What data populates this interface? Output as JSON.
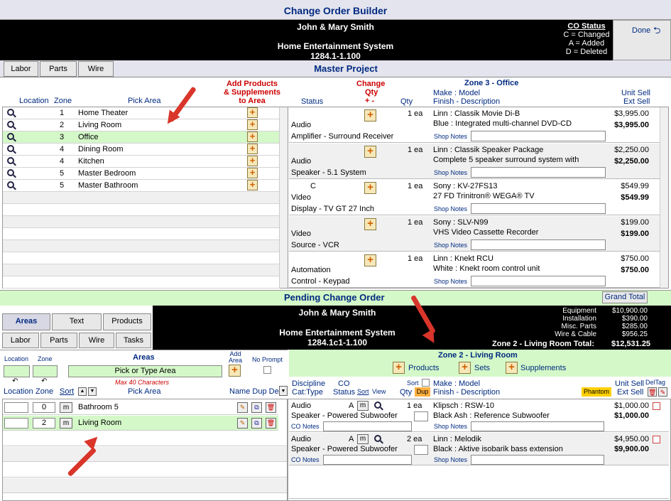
{
  "app_title": "Change Order Builder",
  "header": {
    "client": "John & Mary Smith",
    "project": "Home Entertainment System",
    "project_no": "1284.1-1.100",
    "co_status_title": "CO Status",
    "co_status": [
      "C = Changed",
      "A = Added",
      "D = Deleted"
    ],
    "done_label": "Done"
  },
  "master_tabs": [
    "Labor",
    "Parts",
    "Wire"
  ],
  "master_title": "Master Project",
  "left_headers": {
    "location": "Location",
    "zone": "Zone",
    "pick_area": "Pick Area",
    "add_products": "Add Products",
    "supplements": "& Supplements",
    "to_area": "to Area"
  },
  "areas": [
    {
      "zone": "1",
      "name": "Home Theater"
    },
    {
      "zone": "2",
      "name": "Living Room"
    },
    {
      "zone": "3",
      "name": "Office"
    },
    {
      "zone": "4",
      "name": "Dining Room"
    },
    {
      "zone": "4",
      "name": "Kitchen"
    },
    {
      "zone": "5",
      "name": "Master Bedroom"
    },
    {
      "zone": "5",
      "name": "Master Bathroom"
    }
  ],
  "right_headers": {
    "status": "Status",
    "change": "Change",
    "qty_h": "Qty",
    "plusminus": "+ -",
    "qty": "Qty",
    "zone": "Zone 3 - Office",
    "make_model": "Make : Model",
    "finish_desc": "Finish - Description",
    "unit_sell": "Unit Sell",
    "ext_sell": "Ext Sell"
  },
  "shop_notes": "Shop Notes",
  "master_items": [
    {
      "status": "",
      "disc": "Audio",
      "cat": "Amplifier - Surround Receiver",
      "qty": "1 ea",
      "make": "Linn : Classik Movie Di-B",
      "desc": "Blue : Integrated multi-channel DVD-CD",
      "unit": "$3,995.00",
      "ext": "$3,995.00"
    },
    {
      "status": "",
      "disc": "Audio",
      "cat": "Speaker - 5.1 System",
      "qty": "1 ea",
      "make": "Linn : Classik Speaker Package",
      "desc": "Complete 5 speaker surround system with",
      "unit": "$2,250.00",
      "ext": "$2,250.00"
    },
    {
      "status": "C",
      "disc": "Video",
      "cat": "Display - TV GT 27 Inch",
      "qty": "1 ea",
      "make": "Sony : KV-27FS13",
      "desc": "27 FD Trinitron® WEGA® TV",
      "unit": "$549.99",
      "ext": "$549.99"
    },
    {
      "status": "",
      "disc": "Video",
      "cat": "Source - VCR",
      "qty": "1 ea",
      "make": "Sony : SLV-N99",
      "desc": "VHS Video Cassette Recorder",
      "unit": "$199.00",
      "ext": "$199.00"
    },
    {
      "status": "",
      "disc": "Automation",
      "cat": "Control - Keypad",
      "qty": "1 ea",
      "make": "Linn : Knekt RCU",
      "desc": "White : Knekt room control unit",
      "unit": "$750.00",
      "ext": "$750.00"
    }
  ],
  "pending_title": "Pending Change Order",
  "grand_total": "Grand Total",
  "pending_tabs_row1": [
    "Areas",
    "Text",
    "Products"
  ],
  "pending_tabs_row2": [
    "Labor",
    "Parts",
    "Wire",
    "Tasks"
  ],
  "pending_header": {
    "client": "John & Mary Smith",
    "project": "Home Entertainment System",
    "project_no": "1284.1c1-1.100"
  },
  "totals": [
    {
      "label": "Equipment",
      "value": "$10,900.00"
    },
    {
      "label": "Installation",
      "value": "$390.00"
    },
    {
      "label": "Misc. Parts",
      "value": "$285.00"
    },
    {
      "label": "Wire & Cable",
      "value": "$956.25"
    }
  ],
  "zone_total": {
    "label": "Zone 2 - Living Room Total:",
    "value": "$12,531.25"
  },
  "area_form": {
    "location": "Location",
    "zone": "Zone",
    "areas": "Areas",
    "add_area": "Add",
    "add_area2": "Area",
    "no_prompt": "No Prompt",
    "pick_placeholder": "Pick or Type Area",
    "max_chars": "Max 40 Characters",
    "location2": "Location",
    "zone2": "Zone",
    "sort": "Sort",
    "pick_area": "Pick Area",
    "name_dup_del": "Name Dup Del"
  },
  "pending_areas": [
    {
      "zone": "0",
      "name": "Bathroom 5"
    },
    {
      "zone": "2",
      "name": "Living Room"
    }
  ],
  "zone2": {
    "title": "Zone 2 - Living Room",
    "products": "Products",
    "sets": "Sets",
    "supplements": "Supplements"
  },
  "zone2_headers": {
    "discipline": "Discipline",
    "cat_type": "Cat:Type",
    "co": "CO",
    "status": "Status",
    "sort": "Sort",
    "view": "View",
    "sort2": "Sort",
    "qty": "Qty",
    "dup": "Dup",
    "make_model": "Make : Model",
    "finish_desc": "Finish - Description",
    "phantom": "Phantom",
    "unit_sell": "Unit Sell",
    "ext_sell": "Ext Sell",
    "deltag": "DelTag"
  },
  "co_notes": "CO Notes",
  "pending_items": [
    {
      "disc": "Audio",
      "cat": "Speaker - Powered Subwoofer",
      "status": "A",
      "qty": "1 ea",
      "make": "Klipsch : RSW-10",
      "desc": "Black Ash : Reference Subwoofer",
      "unit": "$1,000.00",
      "ext": "$1,000.00"
    },
    {
      "disc": "Audio",
      "cat": "Speaker - Powered Subwoofer",
      "status": "A",
      "qty": "2 ea",
      "make": "Linn : Melodik",
      "desc": "Black : Aktive isobarik bass extension",
      "unit": "$4,950.00",
      "ext": "$9,900.00"
    }
  ],
  "m_label": "m",
  "colors": {
    "title_blue": "#002a80",
    "green": "#d4f8c8",
    "arrow": "#d9352a"
  }
}
